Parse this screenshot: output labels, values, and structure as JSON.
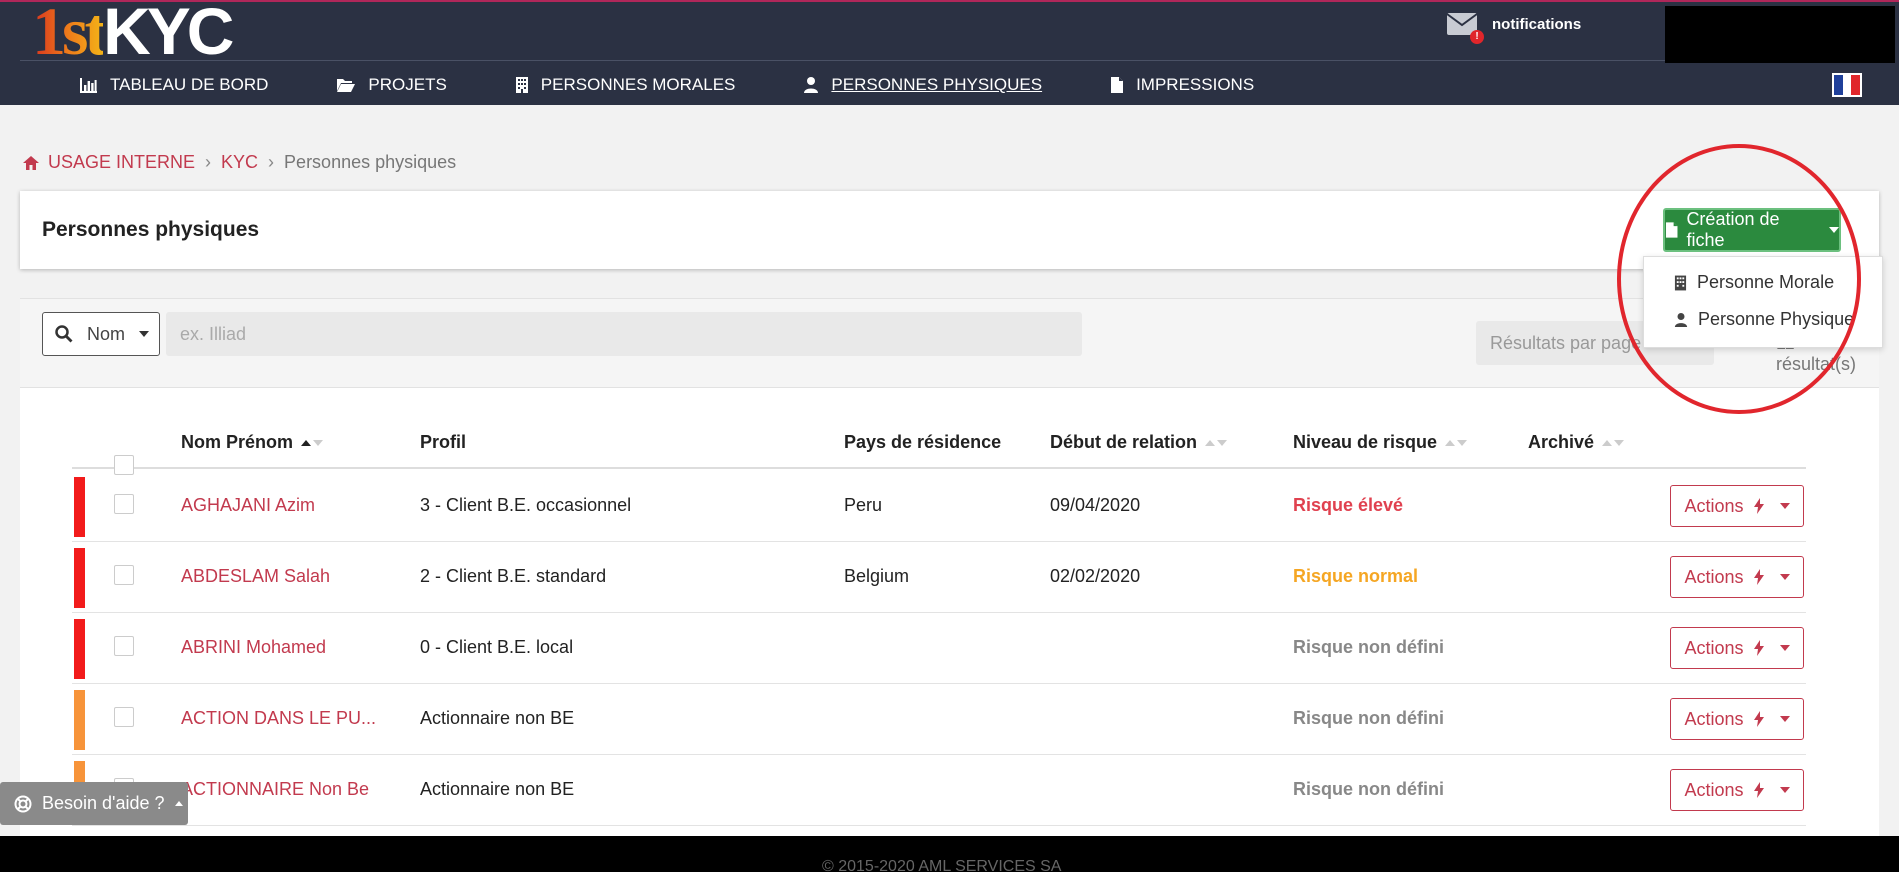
{
  "header": {
    "logo_first": "1st",
    "logo_second": "KYC",
    "notifications_label": "notifications",
    "notifications_badge": "!",
    "nav": [
      {
        "label": "TABLEAU DE BORD",
        "icon": "bar-chart-icon"
      },
      {
        "label": "PROJETS",
        "icon": "folder-open-icon"
      },
      {
        "label": "PERSONNES MORALES",
        "icon": "building-icon"
      },
      {
        "label": "PERSONNES PHYSIQUES",
        "icon": "user-icon",
        "active": true
      },
      {
        "label": "IMPRESSIONS",
        "icon": "file-icon"
      }
    ],
    "flag_colors": [
      "#1f3f9a",
      "#ffffff",
      "#e0262b"
    ]
  },
  "breadcrumb": {
    "home": "USAGE INTERNE",
    "kyc": "KYC",
    "current": "Personnes physiques",
    "separator": "›"
  },
  "page": {
    "title": "Personnes physiques",
    "create_button": "Création de fiche",
    "create_menu": [
      "Personne Morale",
      "Personne Physique"
    ]
  },
  "filter": {
    "select_value": "Nom",
    "search_placeholder": "ex. Illiad",
    "per_page_placeholder": "Résultats par page",
    "results_text": "11 résultat(s)"
  },
  "table": {
    "columns": {
      "name": "Nom Prénom",
      "profile": "Profil",
      "country": "Pays de résidence",
      "start": "Début de relation",
      "risk": "Niveau de risque",
      "archived": "Archivé"
    },
    "action_label": "Actions",
    "rows": [
      {
        "name": "AGHAJANI Azim",
        "profile": "3 - Client B.E. occasionnel",
        "country": "Peru",
        "start": "09/04/2020",
        "risk": "Risque élevé",
        "risk_color": "#e0414f",
        "bar_color": "#f21b1b"
      },
      {
        "name": "ABDESLAM Salah",
        "profile": "2 - Client B.E. standard",
        "country": "Belgium",
        "start": "02/02/2020",
        "risk": "Risque normal",
        "risk_color": "#f5a623",
        "bar_color": "#f21b1b"
      },
      {
        "name": "ABRINI Mohamed",
        "profile": "0 - Client B.E. local",
        "country": "",
        "start": "",
        "risk": "Risque non défini",
        "risk_color": "#888888",
        "bar_color": "#f21b1b"
      },
      {
        "name": "ACTION DANS LE PU...",
        "profile": "Actionnaire non BE",
        "country": "",
        "start": "",
        "risk": "Risque non défini",
        "risk_color": "#888888",
        "bar_color": "#f7943a"
      },
      {
        "name": "ACTIONNAIRE Non Be",
        "profile": "Actionnaire non BE",
        "country": "",
        "start": "",
        "risk": "Risque non défini",
        "risk_color": "#888888",
        "bar_color": "#f7943a"
      }
    ]
  },
  "help": {
    "label": "Besoin d'aide ?"
  },
  "footer": {
    "copyright": "© 2015-2020 AML SERVICES SA"
  }
}
